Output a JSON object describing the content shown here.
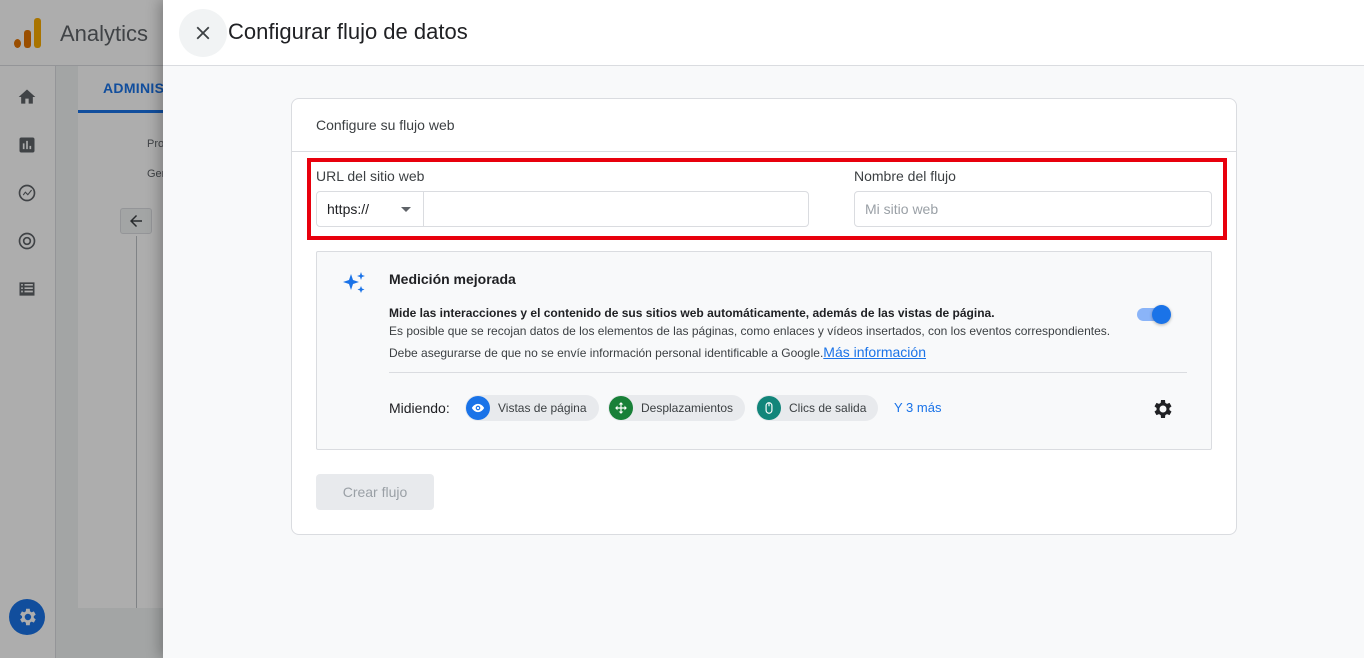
{
  "app": {
    "name": "Analytics",
    "admin_tab": "ADMINIST",
    "admin_texts": [
      "Pro",
      "Gen"
    ]
  },
  "panel": {
    "title": "Configurar flujo de datos",
    "close_icon": "close-icon"
  },
  "card": {
    "title": "Configure su flujo web",
    "url_label": "URL del sitio web",
    "protocol_value": "https://",
    "url_value": "",
    "name_label": "Nombre del flujo",
    "name_placeholder": "Mi sitio web",
    "name_value": ""
  },
  "enhanced": {
    "title": "Medición mejorada",
    "line1": "Mide las interacciones y el contenido de sus sitios web automáticamente, además de las vistas de página.",
    "line2": "Es posible que se recojan datos de los elementos de las páginas, como enlaces y vídeos insertados, con los eventos correspondientes.",
    "line3": "Debe asegurarse de que no se envíe información personal identificable a Google.",
    "link": "Más información",
    "toggle_on": true,
    "measuring_label": "Midiendo:",
    "chips": [
      {
        "label": "Vistas de página",
        "icon": "eye-icon",
        "color": "#1a73e8"
      },
      {
        "label": "Desplazamientos",
        "icon": "move-icon",
        "color": "#188038"
      },
      {
        "label": "Clics de salida",
        "icon": "mouse-icon",
        "color": "#12857a"
      }
    ],
    "more_link": "Y 3 más"
  },
  "actions": {
    "create_label": "Crear flujo"
  },
  "colors": {
    "accent": "#1a73e8",
    "highlight": "#e8000d"
  }
}
